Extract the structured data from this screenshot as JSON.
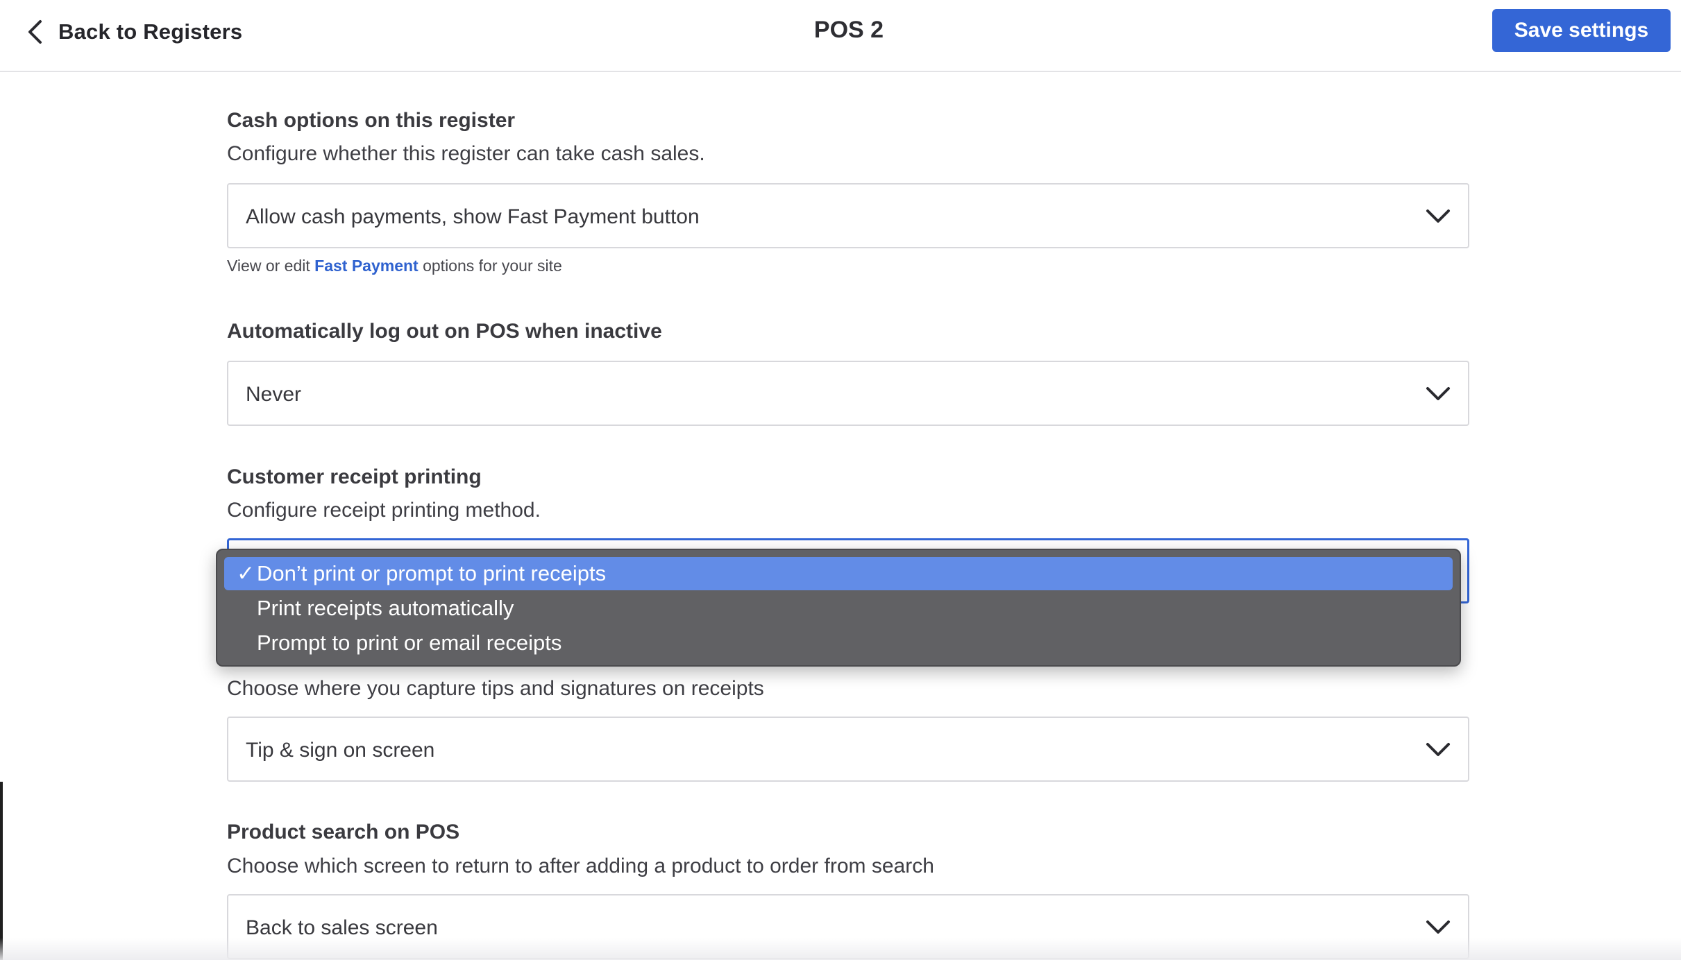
{
  "header": {
    "back_label": "Back to Registers",
    "title": "POS 2",
    "save_label": "Save settings"
  },
  "cash": {
    "title": "Cash options on this register",
    "description": "Configure whether this register can take cash sales.",
    "value": "Allow cash payments, show Fast Payment button",
    "hint_prefix": "View or edit ",
    "hint_link": "Fast Payment",
    "hint_suffix": " options for your site"
  },
  "logout": {
    "title": "Automatically log out on POS when inactive",
    "value": "Never"
  },
  "receipt": {
    "title": "Customer receipt printing",
    "description": "Configure receipt printing method.",
    "options": [
      {
        "label": "Don’t print or prompt to print receipts",
        "selected": true,
        "check": "✓"
      },
      {
        "label": "Print receipts automatically",
        "selected": false,
        "check": ""
      },
      {
        "label": "Prompt to print or email receipts",
        "selected": false,
        "check": ""
      }
    ]
  },
  "tips": {
    "description": "Choose where you capture tips and signatures on receipts",
    "value": "Tip & sign on screen"
  },
  "search": {
    "title": "Product search on POS",
    "description": "Choose which screen to return to after adding a product to order from search",
    "value": "Back to sales screen"
  },
  "icons": {
    "back": "chevron-left-icon",
    "select": "chevron-down-icon",
    "check": "checkmark-icon"
  },
  "colors": {
    "accent": "#3466d6",
    "dropdown_bg": "#616164",
    "dropdown_selected": "#628ce7"
  }
}
